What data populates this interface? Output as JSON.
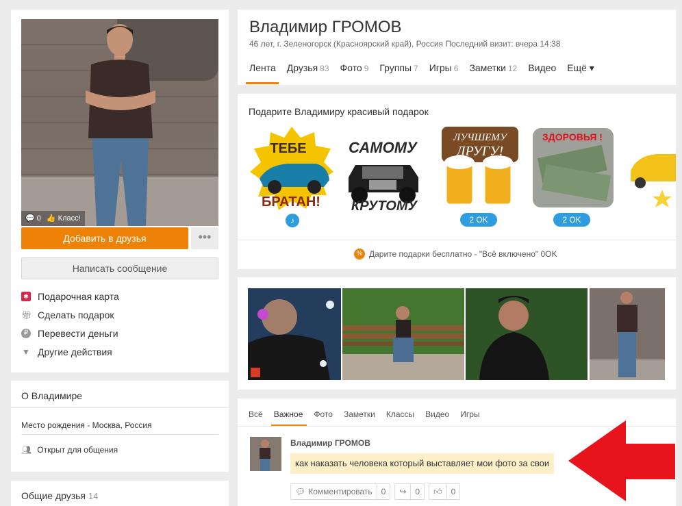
{
  "profile": {
    "name": "Владимир ГРОМОВ",
    "subtitle": "46 лет, г. Зеленогорск (Красноярский край), Россия",
    "last_visit": "Последний визит: вчера 14:38",
    "photo_comments": "0",
    "photo_likes": "Класс!"
  },
  "left_actions": {
    "add_friend": "Добавить в друзья",
    "more": "•••",
    "message": "Написать сообщение",
    "items": [
      {
        "label": "Подарочная карта",
        "icon": "gift-card-icon"
      },
      {
        "label": "Сделать подарок",
        "icon": "gift-icon"
      },
      {
        "label": "Перевести деньги",
        "icon": "ruble-icon"
      },
      {
        "label": "Другие действия",
        "icon": "triangle-down-icon"
      }
    ]
  },
  "about": {
    "title": "О Владимире",
    "birthplace": "Место рождения - Москва, Россия",
    "open": "Открыт для общения"
  },
  "mutual_friends": {
    "title": "Общие друзья",
    "count": "14"
  },
  "tabs": [
    {
      "label": "Лента",
      "count": ""
    },
    {
      "label": "Друзья",
      "count": "83"
    },
    {
      "label": "Фото",
      "count": "9"
    },
    {
      "label": "Группы",
      "count": "7"
    },
    {
      "label": "Игры",
      "count": "6"
    },
    {
      "label": "Заметки",
      "count": "12"
    },
    {
      "label": "Видео",
      "count": ""
    },
    {
      "label": "Ещё ▾",
      "count": ""
    }
  ],
  "gifts": {
    "title": "Подарите Владимиру красивый подарок",
    "items": [
      {
        "line1": "ТЕБЕ",
        "line2": "БРАТАН!",
        "badge": "♪"
      },
      {
        "line1": "САМОМУ",
        "line2": "КРУТОМУ",
        "badge": ""
      },
      {
        "line1": "ЛУЧШЕМУ",
        "line2": "ДРУГУ!",
        "badge": "2 OK"
      },
      {
        "line1": "ЗДОРОВЬЯ !",
        "line2": "",
        "badge": "2 OK"
      }
    ],
    "free_text": "Дарите подарки бесплатно - \"Всё включено\" 0OK"
  },
  "feed": {
    "tabs": [
      "Всё",
      "Важное",
      "Фото",
      "Заметки",
      "Классы",
      "Видео",
      "Игры"
    ],
    "author": "Владимир ГРОМОВ",
    "text": "как наказать человека который выставляет мои фото за свои",
    "comment_label": "Комментировать",
    "comment_count": "0",
    "share_count": "0",
    "like_count": "0"
  },
  "colors": {
    "accent": "#ee8208",
    "badge": "#2d9de0",
    "highlight": "#fdf0c8",
    "arrow": "#e8141c"
  }
}
